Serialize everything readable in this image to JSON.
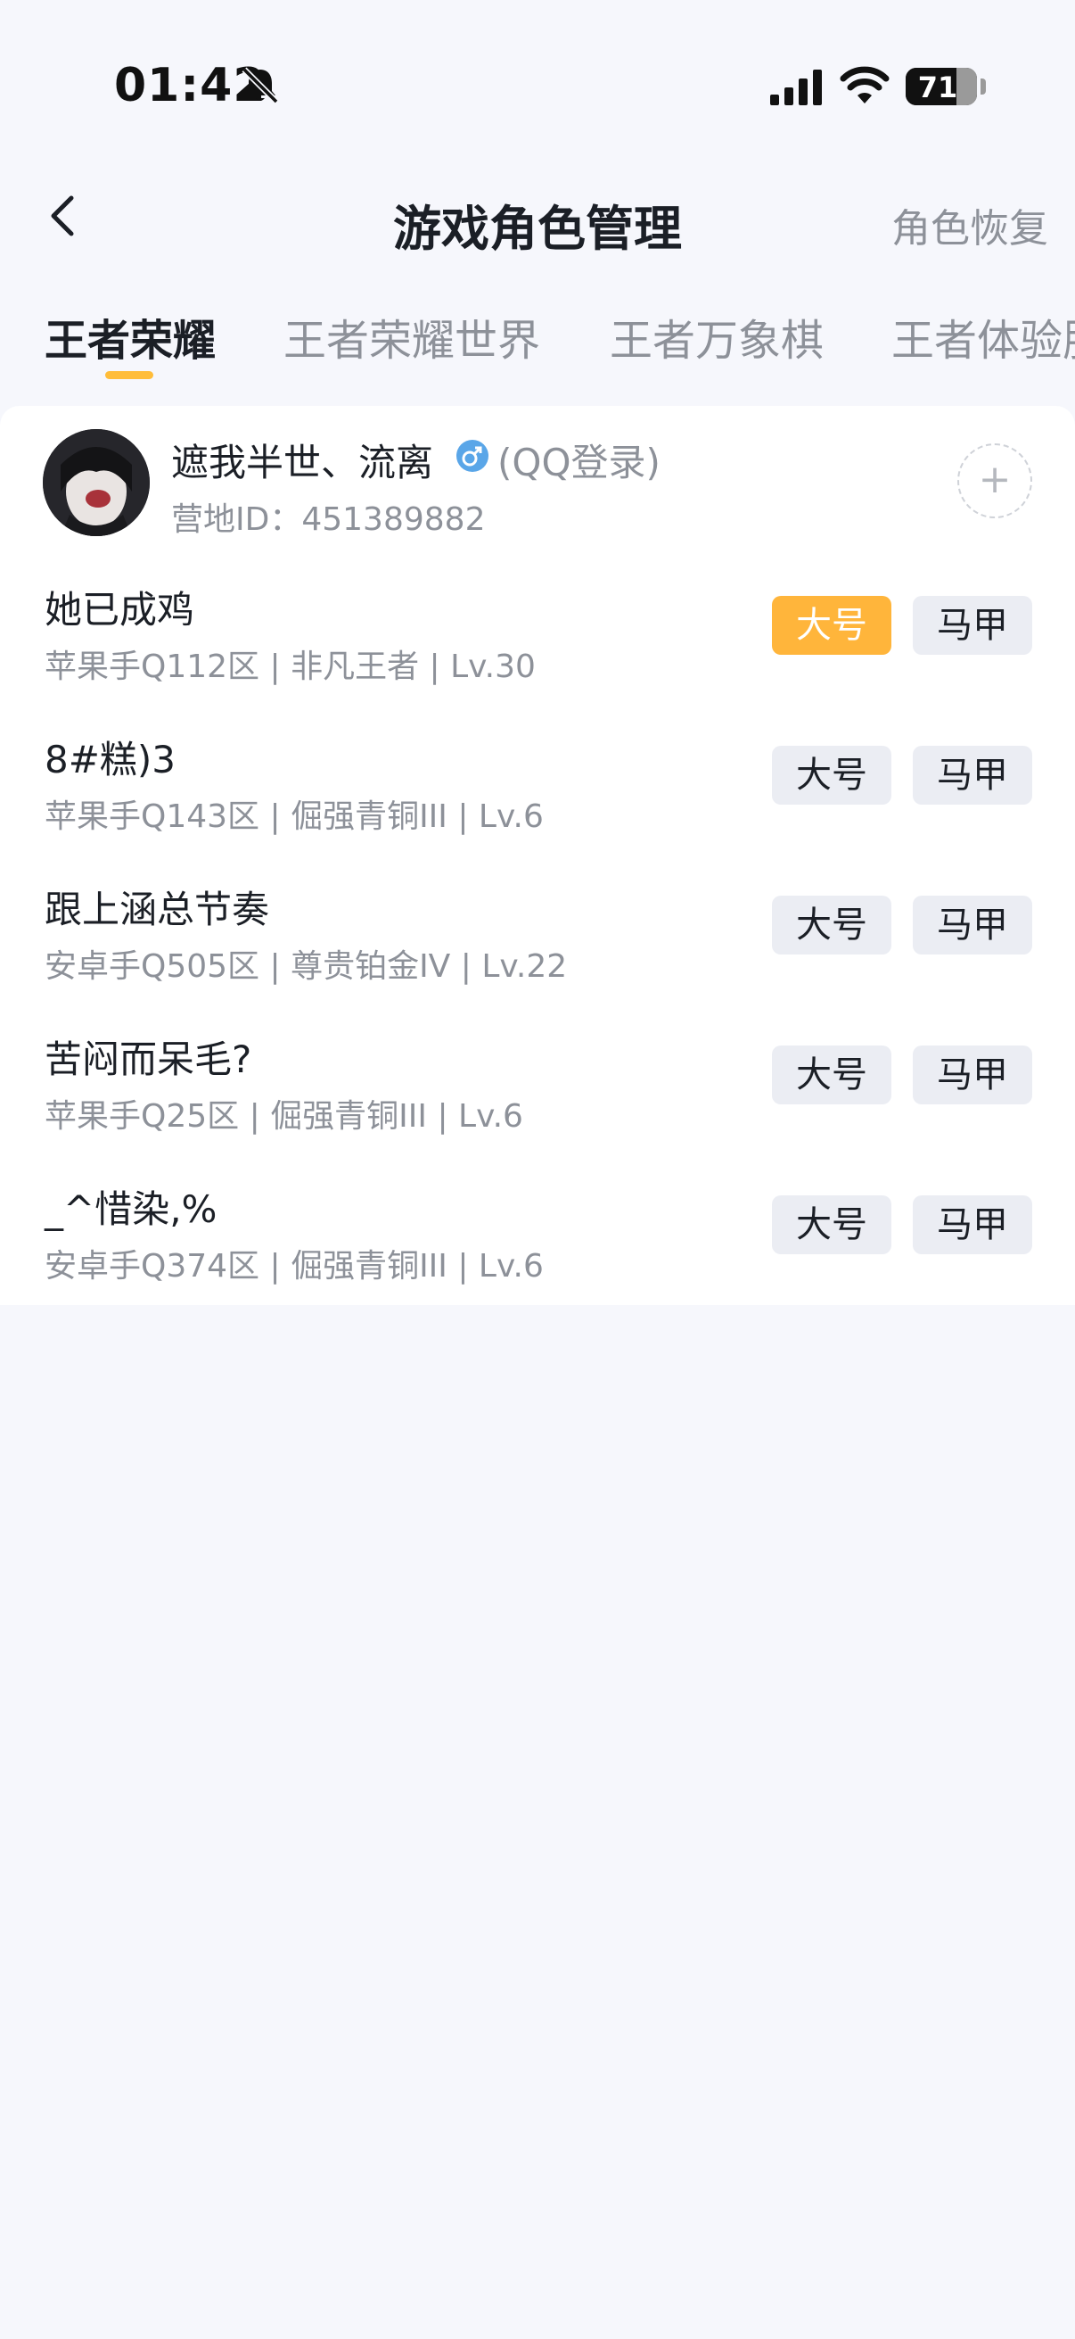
{
  "status_bar": {
    "time": "01:42",
    "battery": "71",
    "battery_level": 0.71,
    "icons": [
      "bell-off-icon",
      "signal-icon",
      "wifi-icon",
      "battery-icon"
    ]
  },
  "nav": {
    "title": "游戏角色管理",
    "action": "角色恢复",
    "back_icon": "chevron-left-icon"
  },
  "tabs": [
    {
      "label": "王者荣耀",
      "active": true
    },
    {
      "label": "王者荣耀世界",
      "active": false
    },
    {
      "label": "王者万象棋",
      "active": false
    },
    {
      "label": "王者体验服",
      "active": false
    }
  ],
  "account": {
    "name": "遮我半世、流离",
    "login_type": "(QQ登录)",
    "id_label": "营地ID：451389882",
    "gender_icon": "male-icon",
    "add_icon": "plus-icon"
  },
  "roles": [
    {
      "name": "她已成鸡",
      "meta": "苹果手Q112区 | 非凡王者 | Lv.30",
      "main_label": "大号",
      "alt_label": "马甲",
      "selected": "main"
    },
    {
      "name": "8#糕)3",
      "meta": "苹果手Q143区 | 倔强青铜III | Lv.6",
      "main_label": "大号",
      "alt_label": "马甲",
      "selected": "none"
    },
    {
      "name": "跟上涵总节奏",
      "meta": "安卓手Q505区 | 尊贵铂金IV | Lv.22",
      "main_label": "大号",
      "alt_label": "马甲",
      "selected": "none"
    },
    {
      "name": "苦闷而呆毛?",
      "meta": "苹果手Q25区 | 倔强青铜III | Lv.6",
      "main_label": "大号",
      "alt_label": "马甲",
      "selected": "none"
    },
    {
      "name": "_^惜染,%",
      "meta": "安卓手Q374区 | 倔强青铜III | Lv.6",
      "main_label": "大号",
      "alt_label": "马甲",
      "selected": "none"
    }
  ],
  "colors": {
    "accent": "#ffb53b",
    "background": "#f6f7fc",
    "card": "#ffffff",
    "button_inactive": "#ebedf3",
    "text_secondary": "#8d9199"
  }
}
